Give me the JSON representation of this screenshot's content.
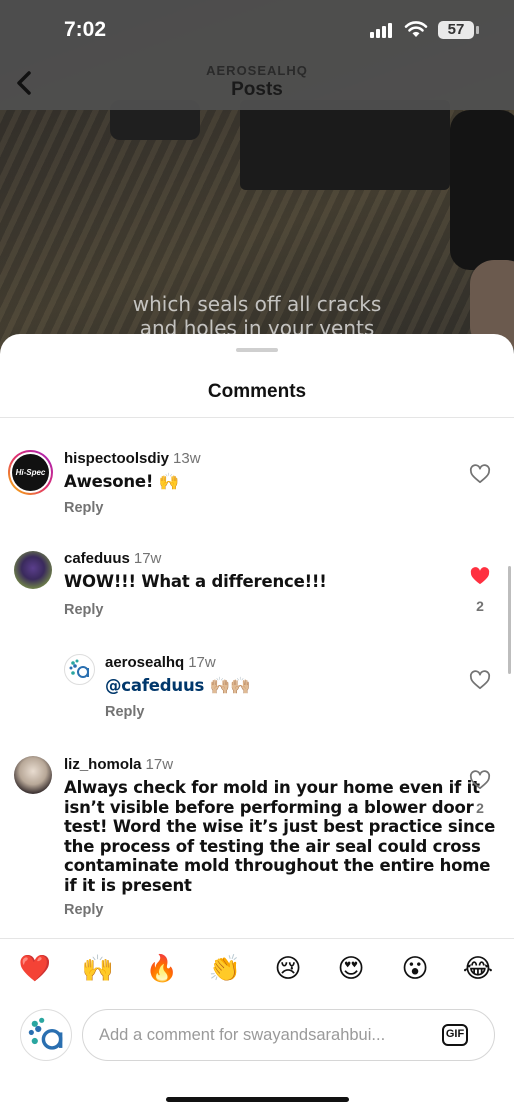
{
  "status_bar": {
    "time": "7:02",
    "battery": "57"
  },
  "header": {
    "account": "AEROSEALHQ",
    "title": "Posts"
  },
  "video": {
    "caption_line1": "which seals off all cracks",
    "caption_line2": "and holes in your vents"
  },
  "sheet": {
    "title": "Comments"
  },
  "comments": [
    {
      "username": "hispectoolsdiy",
      "age": "13w",
      "text": "Awesone! 🙌",
      "reply": "Reply",
      "liked": false,
      "likes": ""
    },
    {
      "username": "cafeduus",
      "age": "17w",
      "text": "WOW!!! What a difference!!!",
      "reply": "Reply",
      "liked": true,
      "likes": "2"
    },
    {
      "username": "aerosealhq",
      "age": "17w",
      "mention": "@cafeduus",
      "text": "🙌🏼🙌🏼",
      "reply": "Reply",
      "liked": false,
      "likes": ""
    },
    {
      "username": "liz_homola",
      "age": "17w",
      "text_lines": [
        "Always check for mold in your home even if it",
        "isn’t visible before performing a blower door",
        "test! Word the wise it’s just best practice since",
        "the process of testing the air seal could cross",
        "contaminate mold throughout the entire home",
        "if it is present"
      ],
      "reply": "Reply",
      "liked": false,
      "likes": "2"
    }
  ],
  "emoji_bar": [
    "❤️",
    "🙌",
    "🔥",
    "👏",
    "😢",
    "😍",
    "😮",
    "😂"
  ],
  "input": {
    "placeholder": "Add a comment for swayandsarahbui...",
    "gif_label": "GIF"
  },
  "colors": {
    "like_red": "#ff3040",
    "mention_blue": "#00376b",
    "secondary_gray": "#737373"
  }
}
